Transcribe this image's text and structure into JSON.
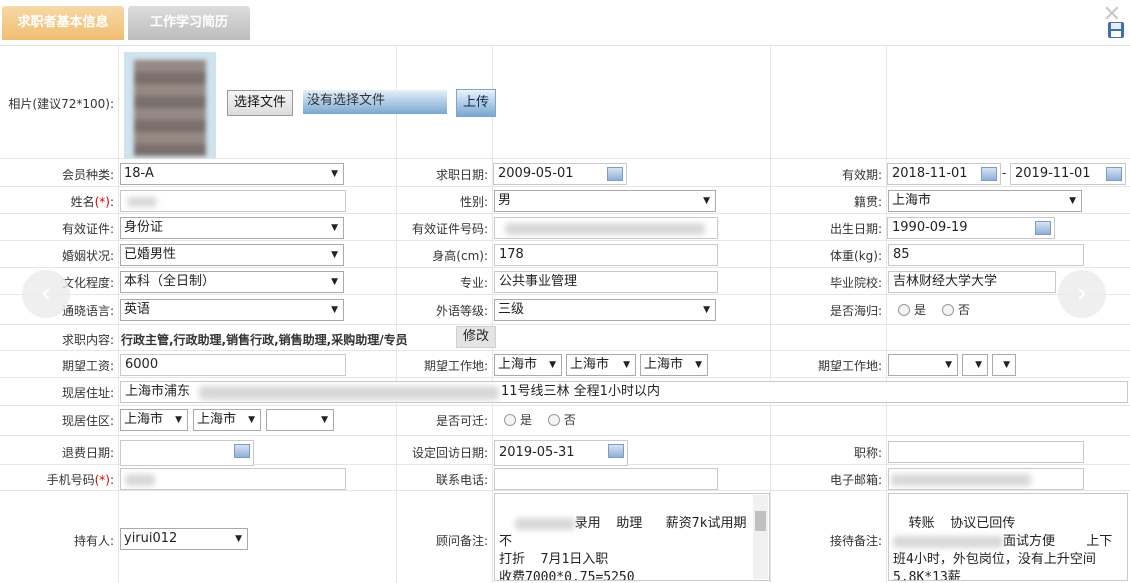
{
  "tabs": [
    {
      "label": "求职者基本信息"
    },
    {
      "label": "工作学习简历"
    }
  ],
  "icons": {
    "close": "close-icon",
    "save": "floppy-disk-icon",
    "calendar": "calendar-icon"
  },
  "photo": {
    "label": "相片(建议72*100):",
    "choose_button": "选择文件",
    "no_file_text": "没有选择文件",
    "upload_button": "上传"
  },
  "fields": {
    "member_type": {
      "label": "会员种类:",
      "value": "18-A"
    },
    "job_date": {
      "label": "求职日期:",
      "value": "2009-05-01"
    },
    "validity": {
      "label": "有效期:",
      "from": "2018-11-01",
      "sep": "-",
      "to": "2019-11-01"
    },
    "name": {
      "label": "姓名",
      "req": "(*)",
      ":": ":"
    },
    "gender": {
      "label": "性别:",
      "value": "男"
    },
    "native_place": {
      "label": "籍贯:",
      "value": "上海市"
    },
    "id_type": {
      "label": "有效证件:",
      "value": "身份证"
    },
    "id_number": {
      "label": "有效证件号码:"
    },
    "birth_date": {
      "label": "出生日期:",
      "value": "1990-09-19"
    },
    "marital": {
      "label": "婚姻状况:",
      "value": "已婚男性"
    },
    "height": {
      "label": "身高(cm):",
      "value": "178"
    },
    "weight": {
      "label": "体重(kg):",
      "value": "85"
    },
    "education": {
      "label": "文化程度:",
      "value": "本科（全日制）"
    },
    "major": {
      "label": "专业:",
      "value": "公共事业管理"
    },
    "school": {
      "label": "毕业院校:",
      "value": "吉林财经大学大学"
    },
    "language": {
      "label": "通晓语言:",
      "value": "英语"
    },
    "lang_level": {
      "label": "外语等级:",
      "value": "三级"
    },
    "returnee": {
      "label": "是否海归:",
      "yes": "是",
      "no": "否"
    },
    "job_content": {
      "label": "求职内容:",
      "value": "行政主管,行政助理,销售行政,销售助理,采购助理/专员",
      "edit": "修改"
    },
    "salary": {
      "label": "期望工资:",
      "value": "6000"
    },
    "work_place": {
      "label": "期望工作地:",
      "v1": "上海市",
      "v2": "上海市",
      "v3": "上海市"
    },
    "work_place2": {
      "label": "期望工作地:"
    },
    "address": {
      "label": "现居住址:",
      "prefix": "上海市浦东",
      "suffix": "11号线三林  全程1小时以内"
    },
    "district": {
      "label": "现居住区:",
      "v1": "上海市",
      "v2": "上海市"
    },
    "relocate": {
      "label": "是否可迁:",
      "yes": "是",
      "no": "否"
    },
    "refund_date": {
      "label": "退费日期:"
    },
    "visit_date": {
      "label": "设定回访日期:",
      "value": "2019-05-31"
    },
    "title": {
      "label": "职称:"
    },
    "phone": {
      "label": "手机号码",
      "req": "(*)",
      ":": ":"
    },
    "contact_phone": {
      "label": "联系电话:"
    },
    "email": {
      "label": "电子邮箱:"
    },
    "holder": {
      "label": "持有人:",
      "value": "yirui012"
    },
    "advisor_note": {
      "label": "顾问备注:",
      "line1": "录用  助理   薪资7k试用期不",
      "line2": "打折  7月1日入职",
      "line3": "收费7000*0.75=5250"
    },
    "reception_note": {
      "label": "接待备注:",
      "line1": "转账  协议已回传",
      "line2": "面试方便    上下",
      "line3": "班4小时，外包岗位，没有上升空间",
      "line4": "5.8K*13薪"
    }
  }
}
